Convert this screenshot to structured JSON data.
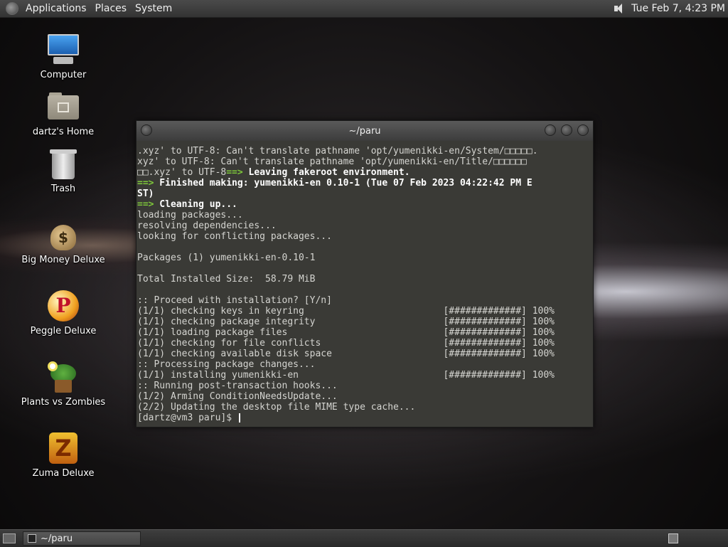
{
  "top_panel": {
    "menus": [
      "Applications",
      "Places",
      "System"
    ],
    "clock": "Tue Feb  7,  4:23 PM"
  },
  "desktop_icons": [
    {
      "label": "Computer",
      "icon": "computer-icon"
    },
    {
      "label": "dartz's Home",
      "icon": "home-folder-icon"
    },
    {
      "label": "Trash",
      "icon": "trash-icon"
    },
    {
      "label": "Big Money Deluxe",
      "icon": "money-bag-icon"
    },
    {
      "label": "Peggle Deluxe",
      "icon": "peggle-icon"
    },
    {
      "label": "Plants vs Zombies",
      "icon": "plants-icon"
    },
    {
      "label": "Zuma Deluxe",
      "icon": "zuma-icon"
    }
  ],
  "window": {
    "title": "~/paru",
    "lines": [
      [
        {
          "t": ".xyz' to UTF-8: Can't translate pathname 'opt/yumenikki-en/System/",
          "s": "n"
        },
        {
          "t": "□□□□□.",
          "s": "n"
        }
      ],
      [
        {
          "t": "xyz' to UTF-8: Can't translate pathname 'opt/yumenikki-en/Title/",
          "s": "n"
        },
        {
          "t": "□□□□□□",
          "s": "n"
        }
      ],
      [
        {
          "t": "□□.xyz' to UTF-8",
          "s": "n"
        },
        {
          "t": "==>",
          "s": "a"
        },
        {
          "t": " Leaving fakeroot environment.",
          "s": "b"
        }
      ],
      [
        {
          "t": "==>",
          "s": "a"
        },
        {
          "t": " Finished making: yumenikki-en 0.10-1 (Tue 07 Feb 2023 04:22:42 PM E",
          "s": "b"
        }
      ],
      [
        {
          "t": "ST)",
          "s": "b"
        }
      ],
      [
        {
          "t": "==>",
          "s": "a"
        },
        {
          "t": " Cleaning up...",
          "s": "b"
        }
      ],
      [
        {
          "t": "loading packages...",
          "s": "n"
        }
      ],
      [
        {
          "t": "resolving dependencies...",
          "s": "n"
        }
      ],
      [
        {
          "t": "looking for conflicting packages...",
          "s": "n"
        }
      ],
      [
        {
          "t": "",
          "s": "n"
        }
      ],
      [
        {
          "t": "Packages (1) yumenikki-en-0.10-1",
          "s": "n"
        }
      ],
      [
        {
          "t": "",
          "s": "n"
        }
      ],
      [
        {
          "t": "Total Installed Size:  58.79 MiB",
          "s": "n"
        }
      ],
      [
        {
          "t": "",
          "s": "n"
        }
      ],
      [
        {
          "t": ":: Proceed with installation? [Y/n]",
          "s": "n"
        }
      ],
      [
        {
          "t": "(1/1) checking keys in keyring                         [#############] 100%",
          "s": "n"
        }
      ],
      [
        {
          "t": "(1/1) checking package integrity                       [#############] 100%",
          "s": "n"
        }
      ],
      [
        {
          "t": "(1/1) loading package files                            [#############] 100%",
          "s": "n"
        }
      ],
      [
        {
          "t": "(1/1) checking for file conflicts                      [#############] 100%",
          "s": "n"
        }
      ],
      [
        {
          "t": "(1/1) checking available disk space                    [#############] 100%",
          "s": "n"
        }
      ],
      [
        {
          "t": ":: Processing package changes...",
          "s": "n"
        }
      ],
      [
        {
          "t": "(1/1) installing yumenikki-en                          [#############] 100%",
          "s": "n"
        }
      ],
      [
        {
          "t": ":: Running post-transaction hooks...",
          "s": "n"
        }
      ],
      [
        {
          "t": "(1/2) Arming ConditionNeedsUpdate...",
          "s": "n"
        }
      ],
      [
        {
          "t": "(2/2) Updating the desktop file MIME type cache...",
          "s": "n"
        }
      ]
    ],
    "prompt": "[dartz@vm3 paru]$ "
  },
  "bottom_panel": {
    "task_label": "~/paru"
  }
}
